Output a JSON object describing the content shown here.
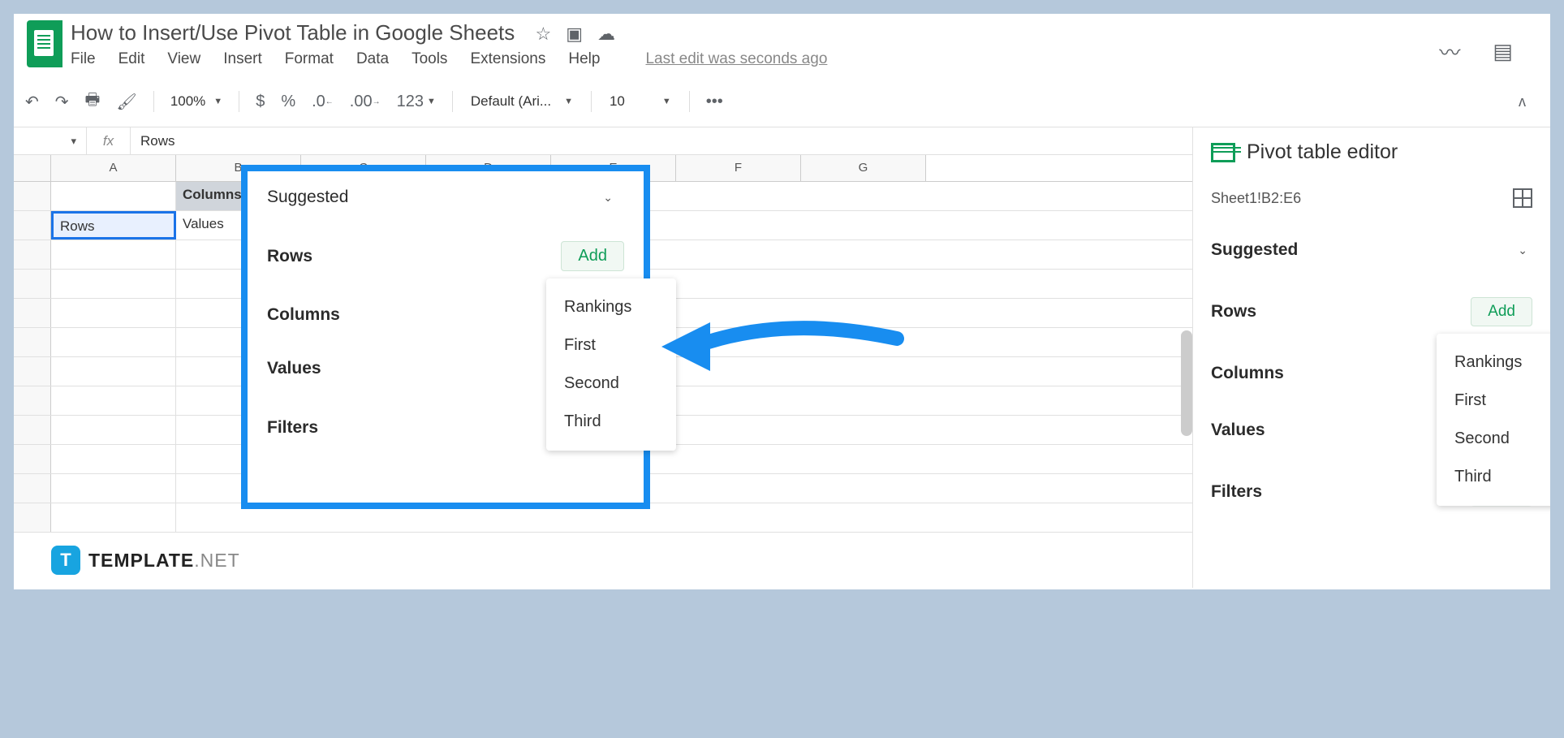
{
  "doc": {
    "title": "How to Insert/Use Pivot Table in Google Sheets",
    "last_edit": "Last edit was seconds ago"
  },
  "menus": {
    "file": "File",
    "edit": "Edit",
    "view": "View",
    "insert": "Insert",
    "format": "Format",
    "data": "Data",
    "tools": "Tools",
    "extensions": "Extensions",
    "help": "Help"
  },
  "toolbar": {
    "zoom": "100%",
    "currency": "$",
    "percent": "%",
    "dec_dec": ".0",
    "inc_dec": ".00",
    "num_fmt": "123",
    "font": "Default (Ari...",
    "font_size": "10",
    "more": "•••"
  },
  "formula": {
    "name_box_caret": "▾",
    "fx": "fx",
    "value": "Rows"
  },
  "columns": [
    "A",
    "B",
    "C",
    "D",
    "E",
    "F",
    "G"
  ],
  "cells": {
    "b1": "Columns",
    "a2": "Rows",
    "b2": "Values"
  },
  "highlight": {
    "suggested": "Suggested",
    "rows": "Rows",
    "columns": "Columns",
    "values": "Values",
    "filters": "Filters",
    "add": "Add",
    "options": [
      "Rankings",
      "First",
      "Second",
      "Third"
    ]
  },
  "sidebar": {
    "title": "Pivot table editor",
    "range": "Sheet1!B2:E6",
    "suggested": "Suggested",
    "rows": "Rows",
    "columns": "Columns",
    "values": "Values",
    "filters": "Filters",
    "add": "Add",
    "options": [
      "Rankings",
      "First",
      "Second",
      "Third"
    ]
  },
  "watermark": {
    "logo": "T",
    "text1": "TEMPLATE",
    "text2": ".NET"
  }
}
